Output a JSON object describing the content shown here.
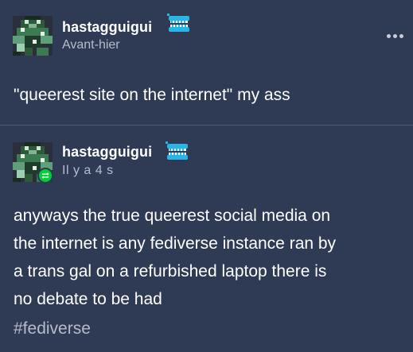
{
  "posts": [
    {
      "username": "hastagguigui",
      "timestamp": "Avant-hier",
      "body": "\"queerest site on the internet\" my ass"
    },
    {
      "username": "hastagguigui",
      "timestamp": "Il y a 4 s",
      "body_lines": [
        "anyways the true queerest social media on",
        "the internet is any fediverse instance ran by",
        "a trans gal on a refurbished laptop there is",
        "no debate to be had"
      ],
      "tag": "#fediverse"
    }
  ],
  "colors": {
    "background": "#2f3a55",
    "text": "#ffffff",
    "muted": "#b7bccb",
    "reblog_green": "#00cf35",
    "badge_blue": "#28b6e8"
  },
  "icons": {
    "more": "more-options-icon",
    "reblog": "reblog-icon",
    "badge": "teeth-badge-icon"
  }
}
